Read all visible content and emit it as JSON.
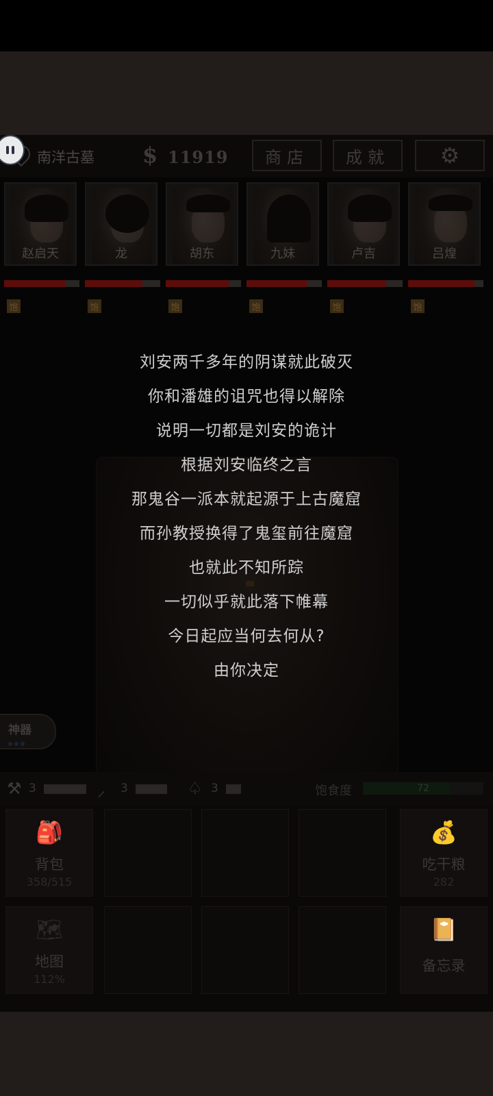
{
  "header": {
    "location": "南洋古墓",
    "currency_symbol": "$",
    "money": "11919",
    "shop_label": "商店",
    "achievements_label": "成就"
  },
  "party": [
    {
      "name": "赵启天",
      "hp": 0.82
    },
    {
      "name": "龙",
      "hp": 0.76
    },
    {
      "name": "胡东",
      "hp": 0.84
    },
    {
      "name": "九妹",
      "hp": 0.8
    },
    {
      "name": "卢吉",
      "hp": 0.78
    },
    {
      "name": "吕煌",
      "hp": 0.88
    }
  ],
  "status_tag": "饱",
  "story": {
    "lines": [
      "刘安两千多年的阴谋就此破灭",
      "你和潘雄的诅咒也得以解除",
      "说明一切都是刘安的诡计",
      "根据刘安临终之言",
      "那鬼谷一派本就起源于上古魔窟",
      "而孙教授换得了鬼玺前往魔窟",
      "也就此不知所踪",
      "一切似乎就此落下帷幕",
      "今日起应当何去何从?",
      "由你决定"
    ]
  },
  "artifact": {
    "label": "神器"
  },
  "tools": [
    {
      "icon": "shovel-icon",
      "count": "3"
    },
    {
      "icon": "pickaxe-icon",
      "count": "3"
    },
    {
      "icon": "spade-icon",
      "count": "3"
    }
  ],
  "satiety": {
    "label": "饱食度",
    "value": "72",
    "level": 0.72
  },
  "grid": {
    "backpack": {
      "label": "背包",
      "sub": "358/515"
    },
    "eat": {
      "label": "吃干粮",
      "sub": "282"
    },
    "map": {
      "label": "地图",
      "sub": "112%"
    },
    "memo": {
      "label": "备忘录"
    }
  }
}
